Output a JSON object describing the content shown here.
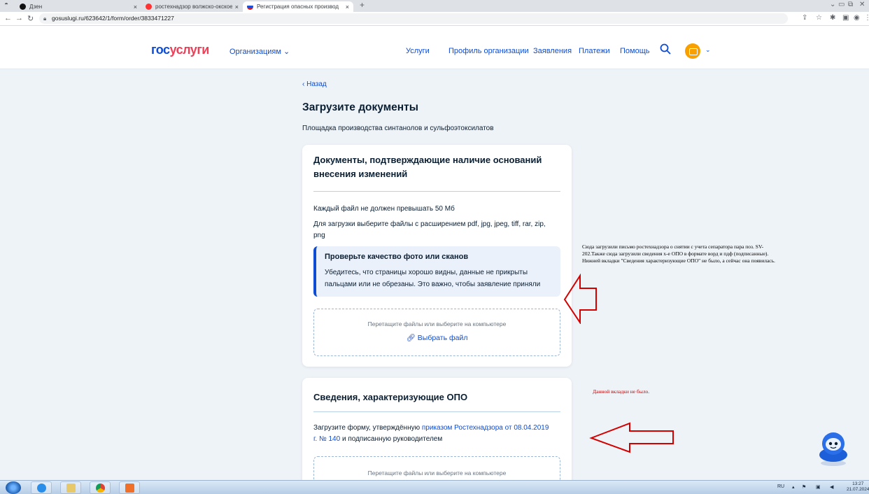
{
  "browser": {
    "tabs": [
      {
        "title": "Дзен",
        "active": false
      },
      {
        "title": "ростехнадзор волжско-окское",
        "active": false
      },
      {
        "title": "Регистрация опасных производ",
        "active": true
      }
    ],
    "new_tab": "+",
    "url": "gosuslugi.ru/623642/1/form/order/3833471227"
  },
  "header": {
    "logo_part1": "гос",
    "logo_part2": "услуги",
    "org_menu": "Организациям ⌄",
    "nav": [
      "Услуги",
      "Профиль организации",
      "Заявления",
      "Платежи",
      "Помощь"
    ],
    "colors": {
      "brand_blue": "#0d4cd3",
      "brand_red": "#ee3f58",
      "avatar": "#f7a000"
    }
  },
  "main": {
    "back": "‹ Назад",
    "title": "Загрузите документы",
    "subtitle": "Площадка производства синтанолов и сульфоэтоксилатов",
    "card1": {
      "title_line1": "Документы, подтверждающие наличие оснований",
      "title_line2": "внесения изменений",
      "limit": "Каждый файл не должен превышать 50 Мб",
      "ext_line1": "Для загрузки выберите файлы с расширением pdf, jpg, jpeg, tiff, rar, zip,",
      "ext_line2": "png",
      "info_title": "Проверьте качество фото или сканов",
      "info_line1": "Убедитесь, что страницы хорошо видны, данные не прикрыты",
      "info_line2": "пальцами или не обрезаны. Это важно, чтобы заявление приняли",
      "drop_hint": "Перетащите файлы или выберите на компьютере",
      "choose_file": "Выбрать файл"
    },
    "card2": {
      "title": "Сведения, характеризующие ОПО",
      "text_before": "Загрузите форму, утверждённую ",
      "link_part1": "приказом Ростехнадзора от 08.04.2019",
      "link_part2": "г. № 140",
      "text_after": " и подписанную руководителем",
      "drop_hint": "Перетащите файлы или выберите на компьютере"
    }
  },
  "annotations": {
    "note1_line1": "Сюда загрузили письмо ростехнадзора о снятии с учета сепаратора пара поз. SV-",
    "note1_line2": "202.Также сюда загрузили сведения х-е ОПО в формате ворд и пдф (подписанные).",
    "note1_line3": "Нижней вкладки \"Сведения характеризующие ОПО\" не было, а сейчас она появилась.",
    "note2": "Данной вкладки не было.",
    "arrow_color": "#d40000"
  },
  "taskbar": {
    "lang": "RU",
    "time": "13:27",
    "date": "21.07.2024"
  }
}
